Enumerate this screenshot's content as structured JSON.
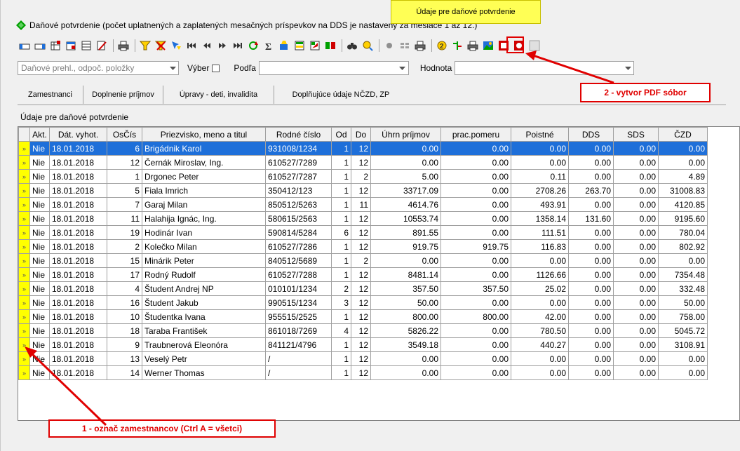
{
  "window": {
    "title": "Daňové potvrdenie (počet uplatnených a zaplatených mesačných príspevkov na DDS je nastavený za mesiace 1 až 12.)",
    "accent": "#00a000"
  },
  "filter": {
    "report_combo": "Daňové prehl., odpoč. položky",
    "vyber_label": "Výber",
    "podla_label": "Podľa",
    "podla_value": "",
    "hodnota_label": "Hodnota",
    "hodnota_value": ""
  },
  "tabs": [
    {
      "label": "Zamestnanci"
    },
    {
      "label": "Doplnenie príjmov"
    },
    {
      "label": "Úpravy - deti, invalidita"
    },
    {
      "label": "Doplňujúce údaje NČZD, ZP"
    },
    {
      "label": "Údaje pre daňové potvrdenie"
    }
  ],
  "section_label": "Údaje pre daňové potvrdenie",
  "annotations": {
    "step1": "1 - označ zamestnancov (Ctrl A = všetci)",
    "step2": "2 - vytvor PDF sóbor",
    "color": "#e00000"
  },
  "table": {
    "row_indicator": "»",
    "columns": [
      "Akt.",
      "Dát. vyhot.",
      "OsČís",
      "Priezvisko, meno a titul",
      "Rodné číslo",
      "Od",
      "Do",
      "Úhrn príjmov",
      "prac.pomeru",
      "Poistné",
      "DDS",
      "SDS",
      "ČZD"
    ],
    "rows": [
      [
        "Nie",
        "18.01.2018",
        "6",
        "Brigádnik Karol",
        "931008/1234",
        "1",
        "12",
        "0.00",
        "0.00",
        "0.00",
        "0.00",
        "0.00",
        "0.00"
      ],
      [
        "Nie",
        "18.01.2018",
        "12",
        "Černák Miroslav, Ing.",
        "610527/7289",
        "1",
        "12",
        "0.00",
        "0.00",
        "0.00",
        "0.00",
        "0.00",
        "0.00"
      ],
      [
        "Nie",
        "18.01.2018",
        "1",
        "Drgonec Peter",
        "610527/7287",
        "1",
        "2",
        "5.00",
        "0.00",
        "0.11",
        "0.00",
        "0.00",
        "4.89"
      ],
      [
        "Nie",
        "18.01.2018",
        "5",
        "Fiala Imrich",
        "350412/123",
        "1",
        "12",
        "33717.09",
        "0.00",
        "2708.26",
        "263.70",
        "0.00",
        "31008.83"
      ],
      [
        "Nie",
        "18.01.2018",
        "7",
        "Garaj Milan",
        "850512/5263",
        "1",
        "11",
        "4614.76",
        "0.00",
        "493.91",
        "0.00",
        "0.00",
        "4120.85"
      ],
      [
        "Nie",
        "18.01.2018",
        "11",
        "Halahija Ignác, Ing.",
        "580615/2563",
        "1",
        "12",
        "10553.74",
        "0.00",
        "1358.14",
        "131.60",
        "0.00",
        "9195.60"
      ],
      [
        "Nie",
        "18.01.2018",
        "19",
        "Hodinár Ivan",
        "590814/5284",
        "6",
        "12",
        "891.55",
        "0.00",
        "111.51",
        "0.00",
        "0.00",
        "780.04"
      ],
      [
        "Nie",
        "18.01.2018",
        "2",
        "Kolečko Milan",
        "610527/7286",
        "1",
        "12",
        "919.75",
        "919.75",
        "116.83",
        "0.00",
        "0.00",
        "802.92"
      ],
      [
        "Nie",
        "18.01.2018",
        "15",
        "Minárik Peter",
        "840512/5689",
        "1",
        "2",
        "0.00",
        "0.00",
        "0.00",
        "0.00",
        "0.00",
        "0.00"
      ],
      [
        "Nie",
        "18.01.2018",
        "17",
        "Rodný Rudolf",
        "610527/7288",
        "1",
        "12",
        "8481.14",
        "0.00",
        "1126.66",
        "0.00",
        "0.00",
        "7354.48"
      ],
      [
        "Nie",
        "18.01.2018",
        "4",
        "Študent Andrej NP",
        "010101/1234",
        "2",
        "12",
        "357.50",
        "357.50",
        "25.02",
        "0.00",
        "0.00",
        "332.48"
      ],
      [
        "Nie",
        "18.01.2018",
        "16",
        "Študent Jakub",
        "990515/1234",
        "3",
        "12",
        "50.00",
        "0.00",
        "0.00",
        "0.00",
        "0.00",
        "50.00"
      ],
      [
        "Nie",
        "18.01.2018",
        "10",
        "Študentka Ivana",
        "955515/2525",
        "1",
        "12",
        "800.00",
        "800.00",
        "42.00",
        "0.00",
        "0.00",
        "758.00"
      ],
      [
        "Nie",
        "18.01.2018",
        "18",
        "Taraba František",
        "861018/7269",
        "4",
        "12",
        "5826.22",
        "0.00",
        "780.50",
        "0.00",
        "0.00",
        "5045.72"
      ],
      [
        "Nie",
        "18.01.2018",
        "9",
        "Traubnerová Eleonóra",
        "841121/4796",
        "1",
        "12",
        "3549.18",
        "0.00",
        "440.27",
        "0.00",
        "0.00",
        "3108.91"
      ],
      [
        "Nie",
        "18.01.2018",
        "13",
        "Veselý Petr",
        "/",
        "1",
        "12",
        "0.00",
        "0.00",
        "0.00",
        "0.00",
        "0.00",
        "0.00"
      ],
      [
        "Nie",
        "18.01.2018",
        "14",
        "Werner Thomas",
        "/",
        "1",
        "12",
        "0.00",
        "0.00",
        "0.00",
        "0.00",
        "0.00",
        "0.00"
      ]
    ]
  }
}
